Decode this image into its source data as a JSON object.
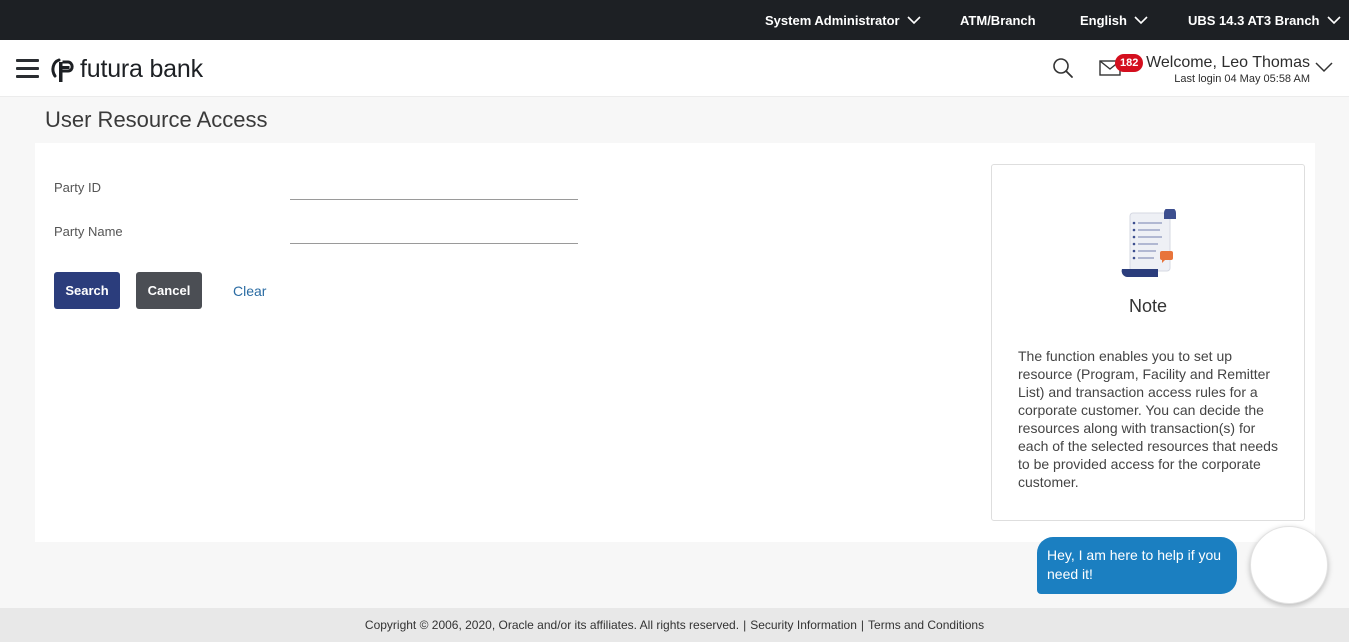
{
  "topbar": {
    "role": "System Administrator",
    "atm_branch": "ATM/Branch",
    "language": "English",
    "branch": "UBS 14.3 AT3 Branch"
  },
  "header": {
    "logo_text": "futura bank",
    "mail_count": "182",
    "welcome": "Welcome, Leo Thomas",
    "last_login": "Last login 04 May 05:58 AM"
  },
  "page": {
    "title": "User Resource Access"
  },
  "form": {
    "party_id_label": "Party ID",
    "party_id_value": "",
    "party_name_label": "Party Name",
    "party_name_value": "",
    "search_label": "Search",
    "cancel_label": "Cancel",
    "clear_label": "Clear"
  },
  "note": {
    "title": "Note",
    "text": "The function enables you to set up resource (Program, Facility and Remitter List) and transaction access rules for a corporate customer. You can decide the resources along with transaction(s) for each of the selected resources that needs to be provided access for the corporate customer."
  },
  "chat": {
    "message": "Hey, I am here to help if you need it!"
  },
  "footer": {
    "copyright": "Copyright © 2006, 2020, Oracle and/or its affiliates. All rights reserved.",
    "security": "Security Information",
    "terms": "Terms and Conditions"
  },
  "colors": {
    "topbar": "#1d2024",
    "primary_button": "#2b3d7c",
    "secondary_button": "#4b4e54",
    "link": "#2b6ca3",
    "badge": "#d40f1e",
    "chat_bubble": "#1b7fc1"
  }
}
